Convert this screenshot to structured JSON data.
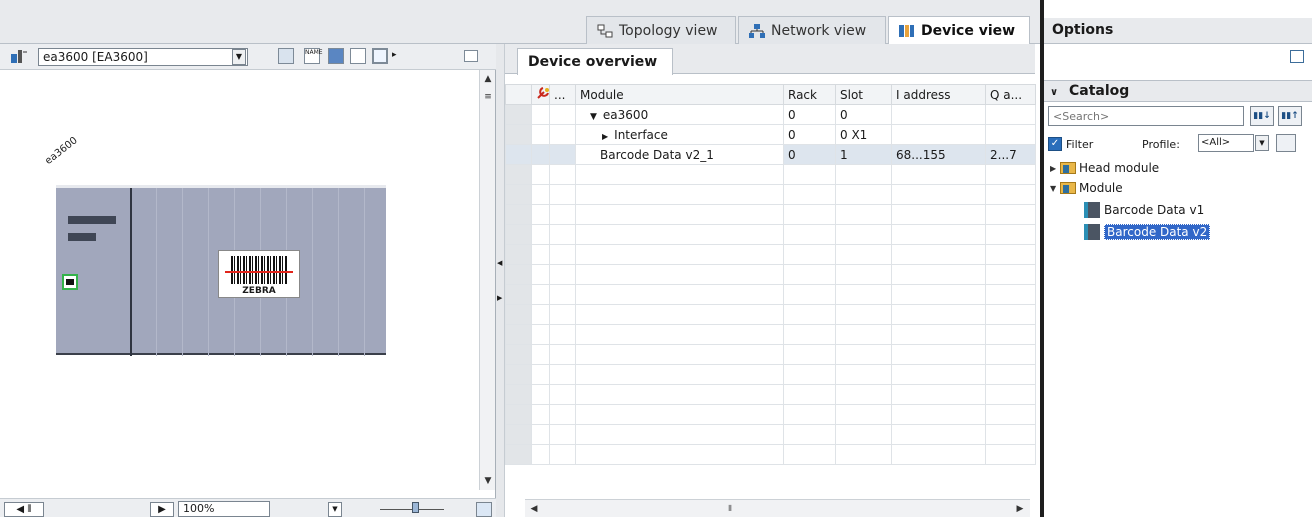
{
  "view_tabs": [
    {
      "label": "Topology view",
      "icon": "topology-icon"
    },
    {
      "label": "Network view",
      "icon": "network-icon"
    },
    {
      "label": "Device view",
      "icon": "device-icon",
      "active": true
    }
  ],
  "left_panel": {
    "device_selector": "ea3600 [EA3600]",
    "device_label": "ea3600",
    "barcode_label": "ZEBRA",
    "zoom": "100%"
  },
  "device_overview": {
    "tab_label": "Device overview",
    "columns": [
      "...",
      "Module",
      "Rack",
      "Slot",
      "I address",
      "Q a..."
    ],
    "rows": [
      {
        "module": "ea3600",
        "expander": "▼",
        "indent": 0,
        "rack": "0",
        "slot": "0",
        "i_address": "",
        "q_address": ""
      },
      {
        "module": "Interface",
        "expander": "▶",
        "indent": 1,
        "rack": "0",
        "slot": "0 X1",
        "i_address": "",
        "q_address": ""
      },
      {
        "module": "Barcode Data v2_1",
        "expander": "",
        "indent": 0,
        "rack": "0",
        "slot": "1",
        "i_address": "68...155",
        "q_address": "2...7",
        "selected": true
      }
    ]
  },
  "options_panel": {
    "title": "Options",
    "catalog_title": "Catalog",
    "search_placeholder": "<Search>",
    "filter_label": "Filter",
    "profile_label": "Profile:",
    "profile_value": "<All>",
    "tree": [
      {
        "label": "Head module",
        "expanded": false,
        "level": 0,
        "kind": "folder"
      },
      {
        "label": "Module",
        "expanded": true,
        "level": 0,
        "kind": "folder"
      },
      {
        "label": "Barcode Data v1",
        "level": 1,
        "kind": "module"
      },
      {
        "label": "Barcode Data v2",
        "level": 1,
        "kind": "module",
        "selected": true
      }
    ]
  },
  "colors": {
    "accent": "#3167c8",
    "rack": "#a1a7bc",
    "port_active": "#34b34a",
    "laser": "#e1251b"
  }
}
